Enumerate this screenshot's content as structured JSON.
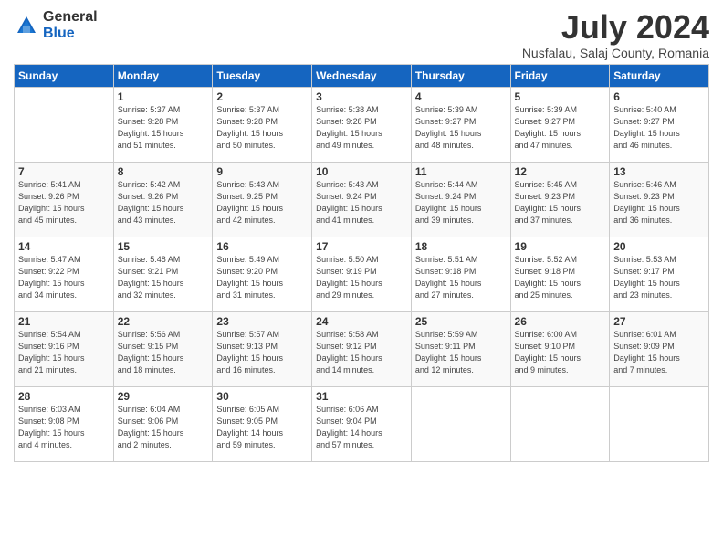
{
  "logo": {
    "general": "General",
    "blue": "Blue"
  },
  "title": "July 2024",
  "subtitle": "Nusfalau, Salaj County, Romania",
  "weekdays": [
    "Sunday",
    "Monday",
    "Tuesday",
    "Wednesday",
    "Thursday",
    "Friday",
    "Saturday"
  ],
  "weeks": [
    [
      {
        "num": "",
        "info": ""
      },
      {
        "num": "1",
        "info": "Sunrise: 5:37 AM\nSunset: 9:28 PM\nDaylight: 15 hours\nand 51 minutes."
      },
      {
        "num": "2",
        "info": "Sunrise: 5:37 AM\nSunset: 9:28 PM\nDaylight: 15 hours\nand 50 minutes."
      },
      {
        "num": "3",
        "info": "Sunrise: 5:38 AM\nSunset: 9:28 PM\nDaylight: 15 hours\nand 49 minutes."
      },
      {
        "num": "4",
        "info": "Sunrise: 5:39 AM\nSunset: 9:27 PM\nDaylight: 15 hours\nand 48 minutes."
      },
      {
        "num": "5",
        "info": "Sunrise: 5:39 AM\nSunset: 9:27 PM\nDaylight: 15 hours\nand 47 minutes."
      },
      {
        "num": "6",
        "info": "Sunrise: 5:40 AM\nSunset: 9:27 PM\nDaylight: 15 hours\nand 46 minutes."
      }
    ],
    [
      {
        "num": "7",
        "info": "Sunrise: 5:41 AM\nSunset: 9:26 PM\nDaylight: 15 hours\nand 45 minutes."
      },
      {
        "num": "8",
        "info": "Sunrise: 5:42 AM\nSunset: 9:26 PM\nDaylight: 15 hours\nand 43 minutes."
      },
      {
        "num": "9",
        "info": "Sunrise: 5:43 AM\nSunset: 9:25 PM\nDaylight: 15 hours\nand 42 minutes."
      },
      {
        "num": "10",
        "info": "Sunrise: 5:43 AM\nSunset: 9:24 PM\nDaylight: 15 hours\nand 41 minutes."
      },
      {
        "num": "11",
        "info": "Sunrise: 5:44 AM\nSunset: 9:24 PM\nDaylight: 15 hours\nand 39 minutes."
      },
      {
        "num": "12",
        "info": "Sunrise: 5:45 AM\nSunset: 9:23 PM\nDaylight: 15 hours\nand 37 minutes."
      },
      {
        "num": "13",
        "info": "Sunrise: 5:46 AM\nSunset: 9:23 PM\nDaylight: 15 hours\nand 36 minutes."
      }
    ],
    [
      {
        "num": "14",
        "info": "Sunrise: 5:47 AM\nSunset: 9:22 PM\nDaylight: 15 hours\nand 34 minutes."
      },
      {
        "num": "15",
        "info": "Sunrise: 5:48 AM\nSunset: 9:21 PM\nDaylight: 15 hours\nand 32 minutes."
      },
      {
        "num": "16",
        "info": "Sunrise: 5:49 AM\nSunset: 9:20 PM\nDaylight: 15 hours\nand 31 minutes."
      },
      {
        "num": "17",
        "info": "Sunrise: 5:50 AM\nSunset: 9:19 PM\nDaylight: 15 hours\nand 29 minutes."
      },
      {
        "num": "18",
        "info": "Sunrise: 5:51 AM\nSunset: 9:18 PM\nDaylight: 15 hours\nand 27 minutes."
      },
      {
        "num": "19",
        "info": "Sunrise: 5:52 AM\nSunset: 9:18 PM\nDaylight: 15 hours\nand 25 minutes."
      },
      {
        "num": "20",
        "info": "Sunrise: 5:53 AM\nSunset: 9:17 PM\nDaylight: 15 hours\nand 23 minutes."
      }
    ],
    [
      {
        "num": "21",
        "info": "Sunrise: 5:54 AM\nSunset: 9:16 PM\nDaylight: 15 hours\nand 21 minutes."
      },
      {
        "num": "22",
        "info": "Sunrise: 5:56 AM\nSunset: 9:15 PM\nDaylight: 15 hours\nand 18 minutes."
      },
      {
        "num": "23",
        "info": "Sunrise: 5:57 AM\nSunset: 9:13 PM\nDaylight: 15 hours\nand 16 minutes."
      },
      {
        "num": "24",
        "info": "Sunrise: 5:58 AM\nSunset: 9:12 PM\nDaylight: 15 hours\nand 14 minutes."
      },
      {
        "num": "25",
        "info": "Sunrise: 5:59 AM\nSunset: 9:11 PM\nDaylight: 15 hours\nand 12 minutes."
      },
      {
        "num": "26",
        "info": "Sunrise: 6:00 AM\nSunset: 9:10 PM\nDaylight: 15 hours\nand 9 minutes."
      },
      {
        "num": "27",
        "info": "Sunrise: 6:01 AM\nSunset: 9:09 PM\nDaylight: 15 hours\nand 7 minutes."
      }
    ],
    [
      {
        "num": "28",
        "info": "Sunrise: 6:03 AM\nSunset: 9:08 PM\nDaylight: 15 hours\nand 4 minutes."
      },
      {
        "num": "29",
        "info": "Sunrise: 6:04 AM\nSunset: 9:06 PM\nDaylight: 15 hours\nand 2 minutes."
      },
      {
        "num": "30",
        "info": "Sunrise: 6:05 AM\nSunset: 9:05 PM\nDaylight: 14 hours\nand 59 minutes."
      },
      {
        "num": "31",
        "info": "Sunrise: 6:06 AM\nSunset: 9:04 PM\nDaylight: 14 hours\nand 57 minutes."
      },
      {
        "num": "",
        "info": ""
      },
      {
        "num": "",
        "info": ""
      },
      {
        "num": "",
        "info": ""
      }
    ]
  ]
}
